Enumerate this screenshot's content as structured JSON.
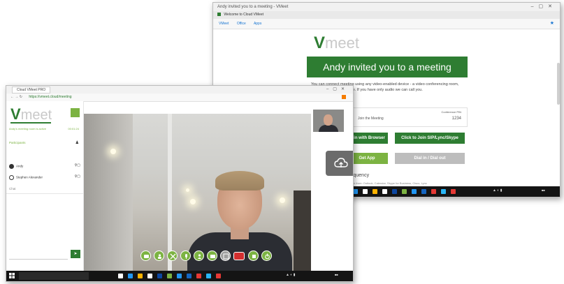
{
  "back_window": {
    "title": "Andy invited you to a meeting - VMeet",
    "tab_label": "Welcome to Cloud VMeet",
    "bookmarks": [
      "VMeet",
      "Office",
      "Apps"
    ],
    "logo_v": "V",
    "logo_text": "meet",
    "invite_banner": "Andy invited you to a meeting",
    "intro_text": "You can connect meeting using any video-enabled device - a video conferencing room, your tablet or smartphone. If you have only audio we can call you.",
    "detail_label": "Join the Meeting",
    "detail_pin_label": "Conference PIN",
    "detail_pin_value": "1234",
    "join_browser_btn": "Join with Browser",
    "join_sip_btn": "Click to Join SIP/Lync/Skype",
    "get_app_btn": "Get App",
    "dial_in_btn": "Dial in / Dial out",
    "frequency_title": "Frequency",
    "frequency_sub": "Join from: Outlook, Calendar, Skype for Business, Cisco, Lync",
    "accent_color": "#2e7d32",
    "secondary_color": "#7cb342"
  },
  "front_window": {
    "tab_label": "Cloud VMeet PRO",
    "url": "https://vmeet.cloud/meeting",
    "logo_v": "V",
    "logo_text": "meet",
    "sidebar": {
      "status": "Andy's meeting room is active",
      "time": "00:01:24",
      "section": "Participants",
      "participants": [
        {
          "name": "Andy"
        },
        {
          "name": "Stephen Alexander"
        }
      ],
      "chat_label": "Chat"
    },
    "icons": {
      "controls": [
        "chat-icon",
        "participants-icon",
        "share-screen-icon",
        "microphone-icon",
        "camera-icon",
        "record-icon",
        "layout-icon",
        "end-call-icon",
        "settings-icon",
        "power-icon"
      ],
      "cloud": "cloud-upload-icon"
    }
  }
}
